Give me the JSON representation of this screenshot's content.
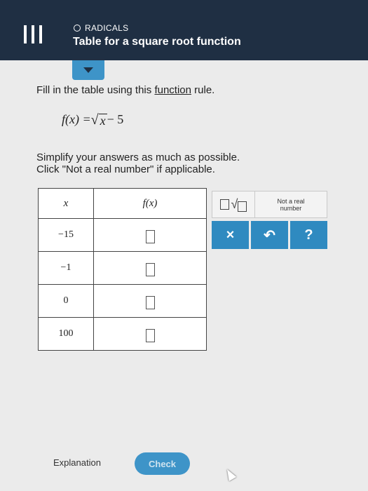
{
  "header": {
    "topic": "RADICALS",
    "title": "Table for a square root function"
  },
  "instructions": {
    "line_prefix": "Fill in the table using this",
    "line_link": "function",
    "line_suffix": "rule.",
    "formula": {
      "lhs": "f(x) = ",
      "radicand": "x",
      "rhs": "− 5"
    },
    "simplify_line1": "Simplify your answers as much as possible.",
    "simplify_line2": "Click \"Not a real number\" if applicable."
  },
  "table": {
    "headers": [
      "x",
      "f(x)"
    ],
    "rows": [
      {
        "x": "−15",
        "fx": ""
      },
      {
        "x": "−1",
        "fx": ""
      },
      {
        "x": "0",
        "fx": ""
      },
      {
        "x": "100",
        "fx": ""
      }
    ]
  },
  "keypad": {
    "not_real_line1": "Not a real",
    "not_real_line2": "number",
    "clear_symbol": "×",
    "undo_symbol": "↶",
    "help_symbol": "?"
  },
  "footer": {
    "explanation": "Explanation",
    "check": "Check"
  },
  "colors": {
    "header_bg": "#1f2f43",
    "accent": "#3e94c8",
    "keypad_button": "#2f8ac0"
  }
}
